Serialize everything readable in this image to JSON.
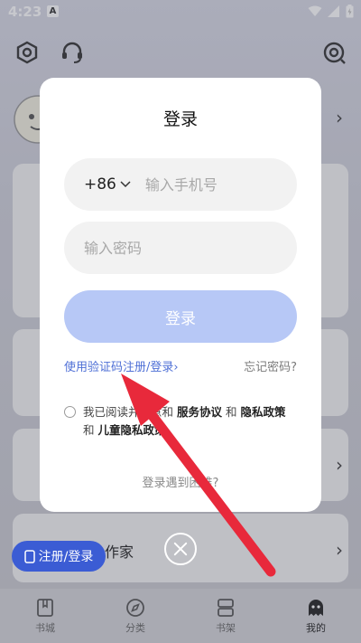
{
  "status_bar": {
    "time": "4:23",
    "notification_letter": "A"
  },
  "background": {
    "author_label": "作家",
    "register_pill_label": "注册/登录"
  },
  "tabs": [
    {
      "label": "书城"
    },
    {
      "label": "分类"
    },
    {
      "label": "书架"
    },
    {
      "label": "我的"
    }
  ],
  "login_modal": {
    "title": "登录",
    "country_code": "+86",
    "phone_placeholder": "输入手机号",
    "password_placeholder": "输入密码",
    "login_button": "登录",
    "sms_login_link": "使用验证码注册/登录",
    "forgot_password_link": "忘记密码?",
    "agreement": {
      "prefix": "我已阅读并同意",
      "and1": "和",
      "service_agreement": "服务协议",
      "and2": "和",
      "privacy_policy": "隐私政策",
      "and3": "和",
      "child_privacy": "儿童隐私政策"
    },
    "trouble_link": "登录遇到困难?"
  },
  "colors": {
    "accent": "#4e6fd6",
    "login_button_disabled": "#b7c8f6",
    "pill": "#3b5cd4",
    "arrow": "#e8293b"
  }
}
